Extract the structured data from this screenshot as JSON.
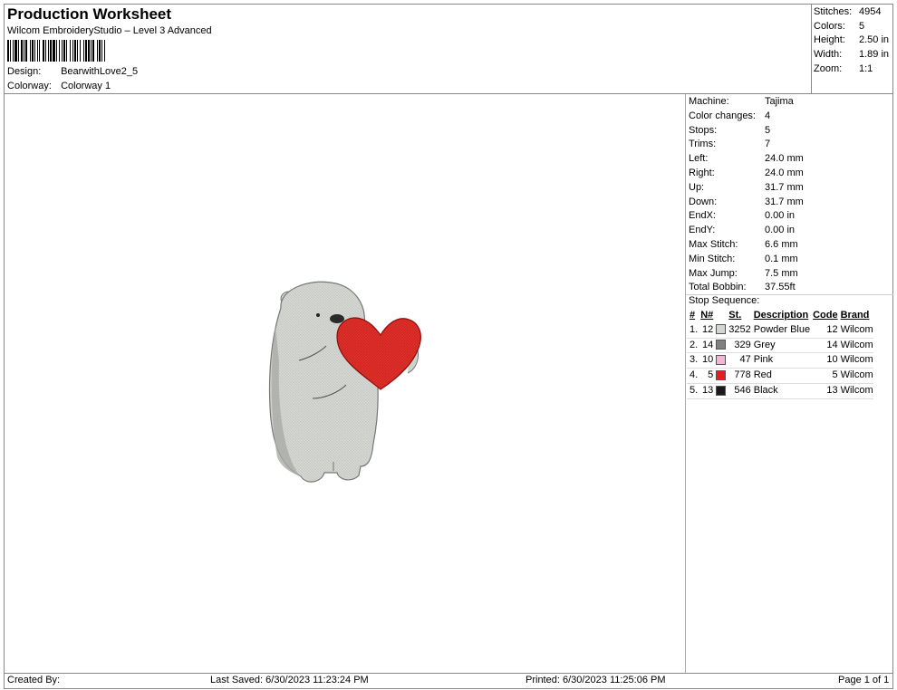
{
  "header": {
    "title": "Production Worksheet",
    "software": "Wilcom EmbroideryStudio – Level 3 Advanced",
    "design_label": "Design:",
    "design_value": "BearwithLove2_5",
    "colorway_label": "Colorway:",
    "colorway_value": "Colorway 1"
  },
  "stats": {
    "stitches_label": "Stitches:",
    "stitches_value": "4954",
    "colors_label": "Colors:",
    "colors_value": "5",
    "height_label": "Height:",
    "height_value": "2.50 in",
    "width_label": "Width:",
    "width_value": "1.89 in",
    "zoom_label": "Zoom:",
    "zoom_value": "1:1"
  },
  "machine_info": [
    {
      "label": "Machine:",
      "value": "Tajima"
    },
    {
      "label": "Color changes:",
      "value": "4"
    },
    {
      "label": "Stops:",
      "value": "5"
    },
    {
      "label": "Trims:",
      "value": "7"
    },
    {
      "label": "Left:",
      "value": "24.0 mm"
    },
    {
      "label": "Right:",
      "value": "24.0 mm"
    },
    {
      "label": "Up:",
      "value": "31.7 mm"
    },
    {
      "label": "Down:",
      "value": "31.7 mm"
    },
    {
      "label": "EndX:",
      "value": "0.00 in"
    },
    {
      "label": "EndY:",
      "value": "0.00 in"
    },
    {
      "label": "Max Stitch:",
      "value": "6.6 mm"
    },
    {
      "label": "Min Stitch:",
      "value": "0.1 mm"
    },
    {
      "label": "Max Jump:",
      "value": "7.5 mm"
    },
    {
      "label": "Total Bobbin:",
      "value": "37.55ft"
    }
  ],
  "stop_sequence": {
    "title": "Stop Sequence:",
    "headers": {
      "num": "#",
      "needle": "N#",
      "stitches": "St.",
      "description": "Description",
      "code": "Code",
      "brand": "Brand"
    },
    "rows": [
      {
        "num": "1.",
        "needle": "12",
        "color": "#d4d6d4",
        "stitches": "3252",
        "description": "Powder Blue",
        "code": "12",
        "brand": "Wilcom"
      },
      {
        "num": "2.",
        "needle": "14",
        "color": "#808080",
        "stitches": "329",
        "description": "Grey",
        "code": "14",
        "brand": "Wilcom"
      },
      {
        "num": "3.",
        "needle": "10",
        "color": "#f5b6d6",
        "stitches": "47",
        "description": "Pink",
        "code": "10",
        "brand": "Wilcom"
      },
      {
        "num": "4.",
        "needle": "5",
        "color": "#e02020",
        "stitches": "778",
        "description": "Red",
        "code": "5",
        "brand": "Wilcom"
      },
      {
        "num": "5.",
        "needle": "13",
        "color": "#1a1a1a",
        "stitches": "546",
        "description": "Black",
        "code": "13",
        "brand": "Wilcom"
      }
    ]
  },
  "footer": {
    "created_by": "Created By:",
    "last_saved": "Last Saved: 6/30/2023 11:23:24 PM",
    "printed": "Printed: 6/30/2023 11:25:06 PM",
    "page": "Page 1 of 1"
  }
}
